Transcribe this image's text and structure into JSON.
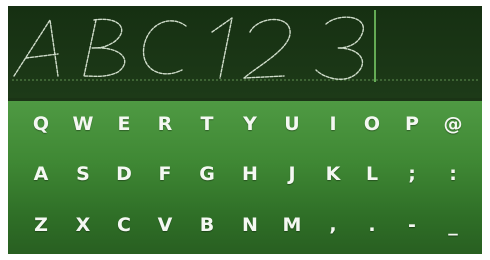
{
  "handwriting_display": {
    "recognized_text": "ABC123",
    "ink_color": "#cfdcca",
    "guide_color": "#5f8f52",
    "cursor_color": "#7dd36a"
  },
  "keyboard": {
    "rows": [
      [
        "Q",
        "W",
        "E",
        "R",
        "T",
        "Y",
        "U",
        "I",
        "O",
        "P",
        "@"
      ],
      [
        "A",
        "S",
        "D",
        "F",
        "G",
        "H",
        "J",
        "K",
        "L",
        ";",
        ":"
      ],
      [
        "Z",
        "X",
        "C",
        "V",
        "B",
        "N",
        "M",
        ",",
        ".",
        "-",
        "_"
      ]
    ]
  }
}
